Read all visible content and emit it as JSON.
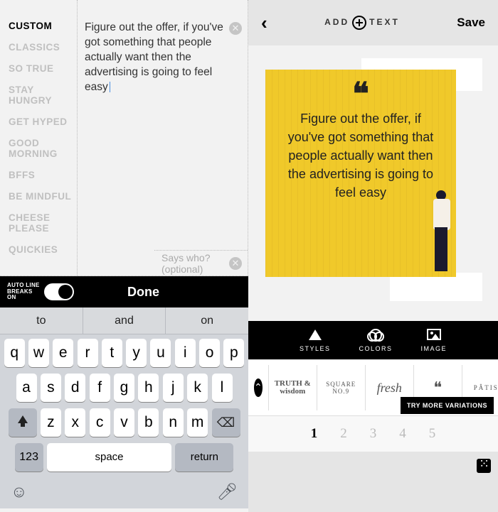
{
  "left": {
    "categories": [
      "CUSTOM",
      "CLASSICS",
      "SO TRUE",
      "STAY HUNGRY",
      "GET HYPED",
      "GOOD MORNING",
      "BFFS",
      "BE MINDFUL",
      "CHEESE PLEASE",
      "QUICKIES"
    ],
    "activeCategory": 0,
    "text": "Figure out the offer, if you've got something that people actually want then the advertising is going to feel easy",
    "attributionPlaceholder": "Says who? (optional)",
    "autoBreakLabel": "AUTO LINE BREAKS ON",
    "doneLabel": "Done",
    "suggestions": [
      "to",
      "and",
      "on"
    ],
    "keyRows": [
      [
        "q",
        "w",
        "e",
        "r",
        "t",
        "y",
        "u",
        "i",
        "o",
        "p"
      ],
      [
        "a",
        "s",
        "d",
        "f",
        "g",
        "h",
        "j",
        "k",
        "l"
      ],
      [
        "z",
        "x",
        "c",
        "v",
        "b",
        "n",
        "m"
      ]
    ],
    "numKey": "123",
    "spaceKey": "space",
    "returnKey": "return"
  },
  "right": {
    "addTextLabelA": "ADD",
    "addTextLabelB": "TEXT",
    "saveLabel": "Save",
    "quoteText": "Figure out the offer, if you've got something that people actually want then the advertising is going to feel easy",
    "tabs": [
      {
        "label": "STYLES"
      },
      {
        "label": "COLORS"
      },
      {
        "label": "IMAGE"
      }
    ],
    "styleItems": [
      "TRUTH & wisdom",
      "SQUARE NO.9",
      "fresh",
      "❝",
      "PÂTIS"
    ],
    "tryMoreLabel": "TRY MORE VARIATIONS",
    "pages": [
      "1",
      "2",
      "3",
      "4",
      "5"
    ],
    "activePage": 0
  }
}
